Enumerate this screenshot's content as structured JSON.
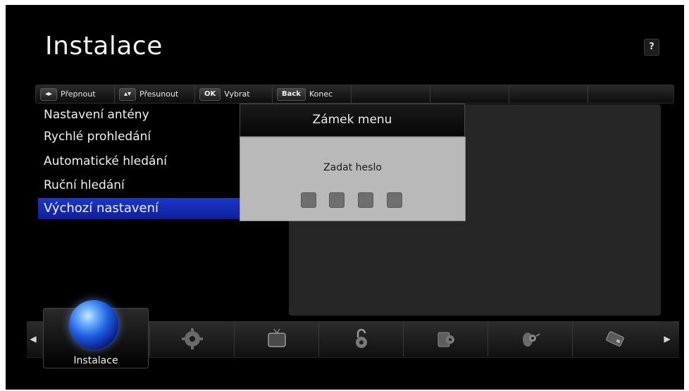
{
  "screen": {
    "title": "Instalace",
    "help_label": "?"
  },
  "hint_bar": [
    {
      "key": "◂▸",
      "label": "Přepnout"
    },
    {
      "key": "▴▾",
      "label": "Přesunout"
    },
    {
      "key": "OK",
      "label": "Vybrat"
    },
    {
      "key": "Back",
      "label": "Konec"
    }
  ],
  "menu": {
    "items": [
      {
        "label": "Nastavení antény"
      },
      {
        "label": "Rychlé prohledání"
      },
      {
        "label": "Automatické hledání"
      },
      {
        "label": "Ruční hledání"
      },
      {
        "label": "Výchozí nastavení"
      }
    ],
    "selected_index": 4,
    "selection_color": "#1530c0"
  },
  "dialog": {
    "title": "Zámek menu",
    "prompt": "Zadat heslo",
    "pin_digits": 4
  },
  "bottom_nav": {
    "active_label": "Instalace",
    "items": [
      {
        "icon": "globe-icon"
      },
      {
        "icon": "gear-icon"
      },
      {
        "icon": "tv-icon"
      },
      {
        "icon": "padlock-icon"
      },
      {
        "icon": "book-icon"
      },
      {
        "icon": "satellite-dish-icon"
      },
      {
        "icon": "card-icon"
      }
    ]
  }
}
